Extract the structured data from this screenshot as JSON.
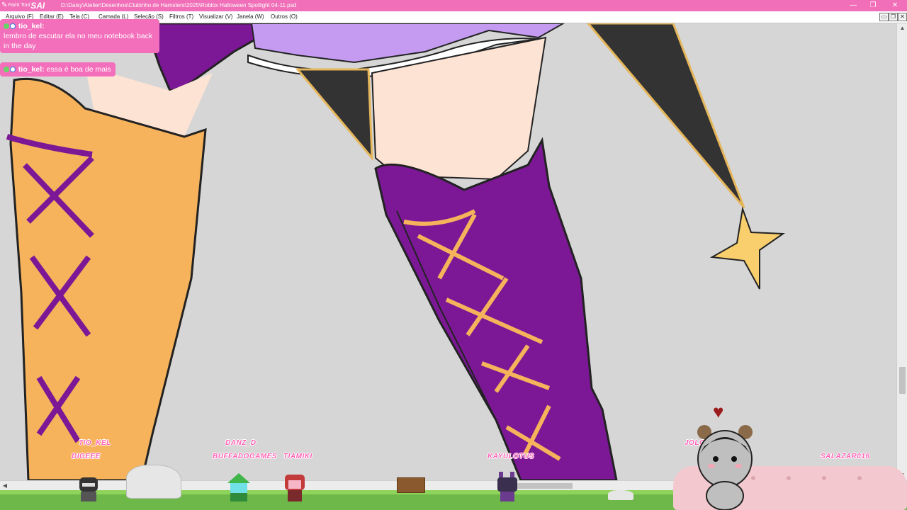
{
  "app": {
    "logo_small": "Paint Tool",
    "logo_big": "SAI",
    "file_path": "D:\\Daisy\\Atelier\\Desenhos\\Clubinho de Hamsters\\2025\\Roblox Halloween Spotlight 04-11.psd"
  },
  "window_controls": {
    "minimize": "—",
    "restore": "❐",
    "close": "✕"
  },
  "menu": [
    "Arquivo (F)",
    "Editar (E)",
    "Tela (C)",
    "Camada (L)",
    "Seleção (S)",
    "Filtros (T)",
    "Visualizar (V)",
    "Janela (W)",
    "Outros (O)"
  ],
  "chat": [
    {
      "user": "tio_kel:",
      "message": "lembro de escutar ela no meu notebook back in the day"
    },
    {
      "user": "tio_kel:",
      "message": "essa é boa de mais"
    }
  ],
  "viewers": [
    "TIO_KEL",
    "DIGEEE",
    "DANZ_D",
    "BUFFADOGAMES",
    "TIAMIKI",
    "KAYULOTUS",
    "JOLO",
    "SALAZAR016"
  ],
  "colors": {
    "titlebar": "#f06fb8",
    "chat_bg": "#f36fbb",
    "canvas_bg": "#d6d6d6",
    "boot_orange": "#f6b35b",
    "boot_purple": "#7c1896",
    "skirt_lavender": "#c49bf0",
    "skin": "#fde3d4",
    "stocking_dark": "#333333",
    "star_yellow": "#f9cf6e"
  }
}
